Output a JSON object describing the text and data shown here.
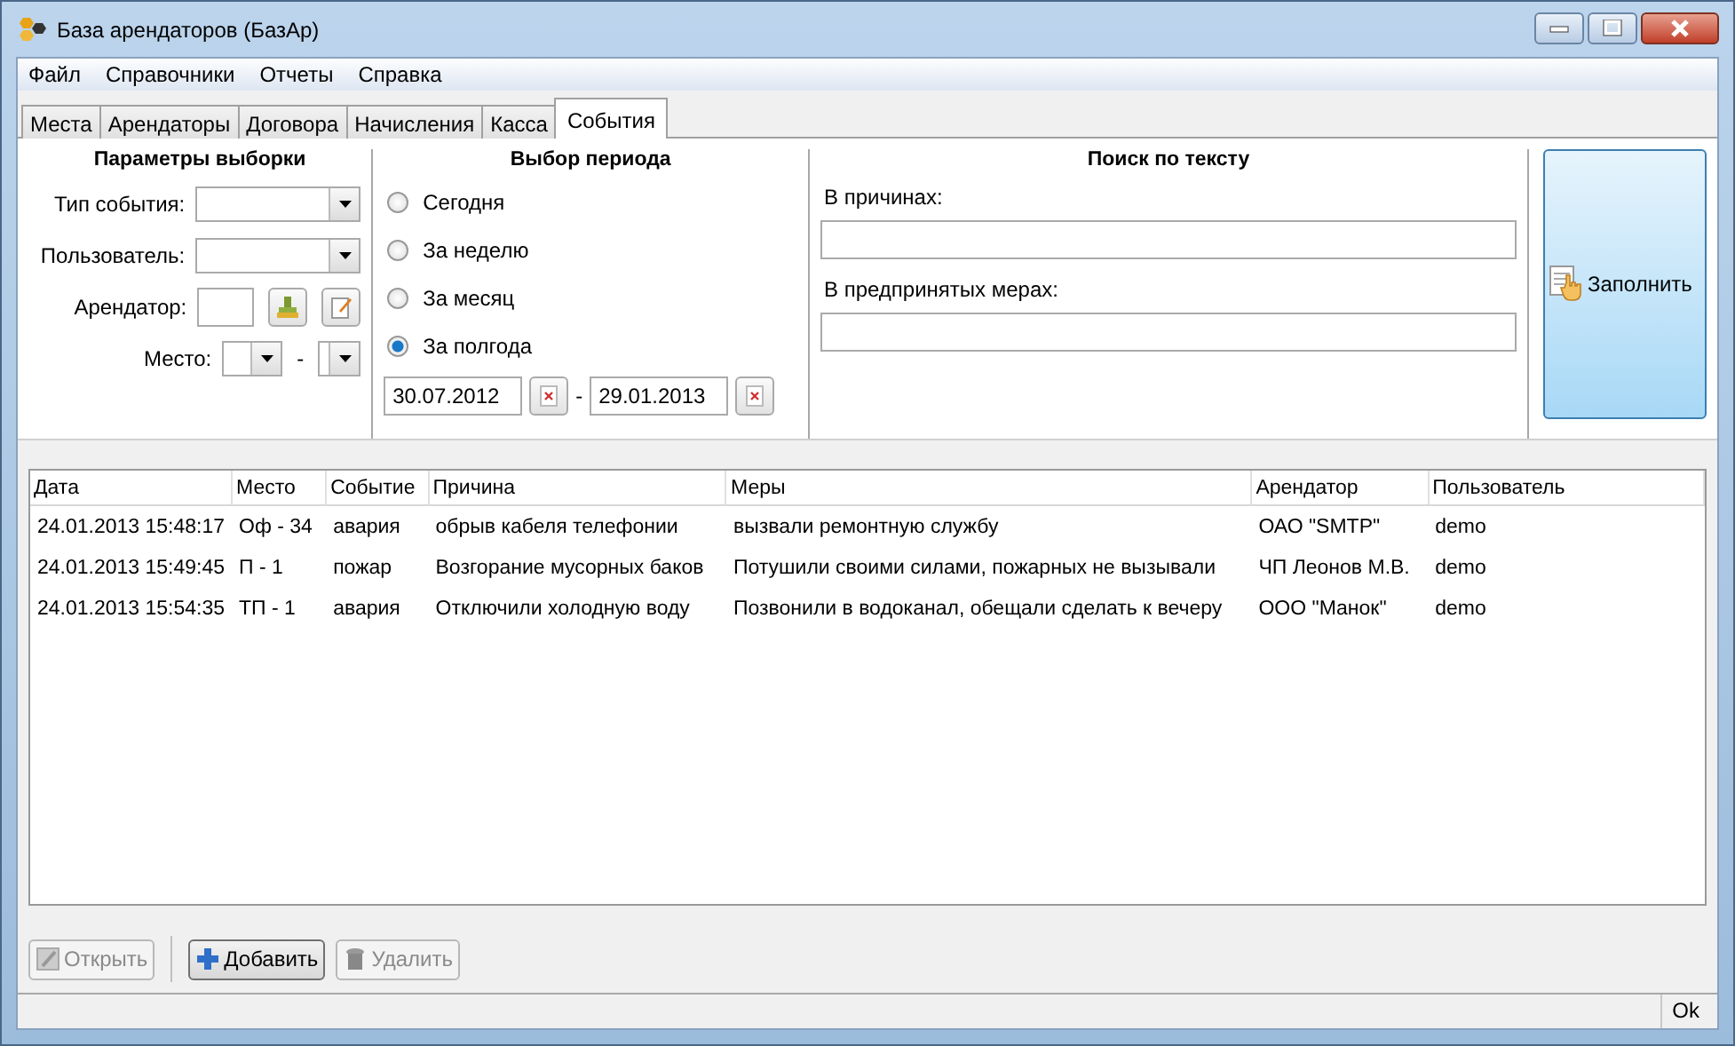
{
  "window": {
    "title": "База арендаторов (БазАр)"
  },
  "menu": [
    "Файл",
    "Справочники",
    "Отчеты",
    "Справка"
  ],
  "tabs": [
    {
      "label": "Места",
      "selected": false
    },
    {
      "label": "Арендаторы",
      "selected": false
    },
    {
      "label": "Договора",
      "selected": false
    },
    {
      "label": "Начисления",
      "selected": false
    },
    {
      "label": "Касса",
      "selected": false
    },
    {
      "label": "События",
      "selected": true
    }
  ],
  "params": {
    "title": "Параметры выборки",
    "event_type_label": "Тип события:",
    "user_label": "Пользователь:",
    "tenant_label": "Арендатор:",
    "place_label": "Место:",
    "place_separator": "-"
  },
  "period": {
    "title": "Выбор периода",
    "options": [
      {
        "label": "Сегодня",
        "selected": false
      },
      {
        "label": "За неделю",
        "selected": false
      },
      {
        "label": "За месяц",
        "selected": false
      },
      {
        "label": "За полгода",
        "selected": true
      }
    ],
    "date_from": "30.07.2012",
    "separator": "-",
    "date_to": "29.01.2013"
  },
  "search": {
    "title": "Поиск по тексту",
    "reasons_label": "В причинах:",
    "measures_label": "В предпринятых мерах:"
  },
  "fill_button": "Заполнить",
  "table": {
    "columns": [
      "Дата",
      "Место",
      "Событие",
      "Причина",
      "Меры",
      "Арендатор",
      "Пользователь"
    ],
    "rows": [
      [
        "24.01.2013 15:48:17",
        "Оф - 34",
        "авария",
        "обрыв кабеля телефонии",
        "вызвали ремонтную службу",
        "ОАО \"SMTP\"",
        "demo"
      ],
      [
        "24.01.2013 15:49:45",
        "П - 1",
        "пожар",
        "Возгорание мусорных баков",
        "Потушили своими силами, пожарных не вызывали",
        "ЧП Леонов М.В.",
        "demo"
      ],
      [
        "24.01.2013 15:54:35",
        "ТП - 1",
        "авария",
        "Отключили холодную воду",
        "Позвонили в водоканал, обещали сделать к вечеру",
        "ООО \"Манок\"",
        "demo"
      ]
    ]
  },
  "buttons": [
    {
      "kind": "open",
      "label": "Открыть",
      "disabled": true
    },
    {
      "kind": "add",
      "label": "Добавить",
      "disabled": false
    },
    {
      "kind": "delete",
      "label": "Удалить",
      "disabled": true
    }
  ],
  "status_bar": {
    "text": "Ok"
  }
}
